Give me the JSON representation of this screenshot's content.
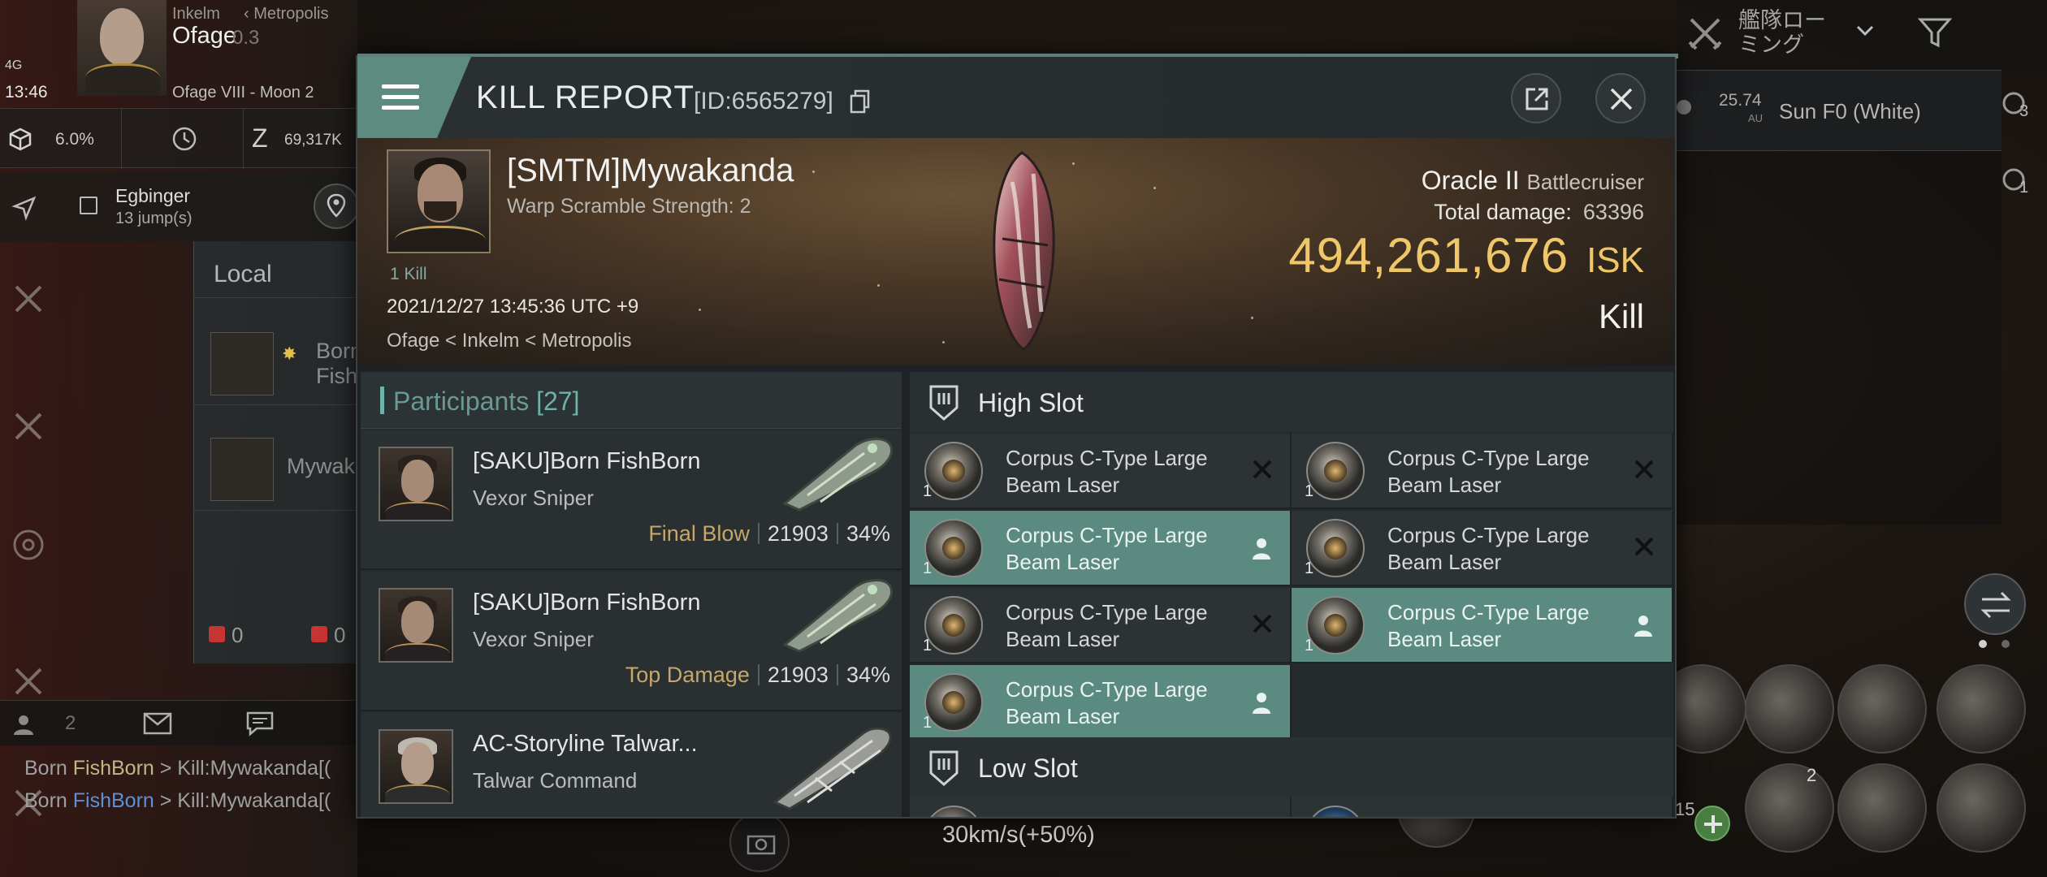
{
  "hud": {
    "region": "Inkelm",
    "constellation": "Metropolis",
    "system": "Ofage",
    "security": "0.3",
    "signal": "4G",
    "time": "13:46",
    "location": "Ofage VIII - Moon 2",
    "stats": [
      "6.0%",
      "69,317K"
    ],
    "route_destination": "Egbinger",
    "route_jumps": "13 jump(s)",
    "local_title": "Local",
    "local_rows": [
      "Born Fish",
      "Mywak"
    ],
    "flags": [
      "0",
      "0"
    ],
    "chat_count": "2",
    "chat_lines": [
      {
        "prefix": "Born ",
        "name": "FishBorn",
        "text": " > Kill:Mywakanda[("
      },
      {
        "prefix": "Born ",
        "name": "FishBorn",
        "text": " > Kill:Mywakanda[("
      }
    ],
    "fleet_label": "艦隊ローミング",
    "sun_distance": "25.74",
    "sun_distance_unit": "AU",
    "sun_name": "Sun F0 (White)",
    "right_counts": [
      "3",
      "1"
    ],
    "speed": "30km/s(+50%)",
    "module_badges": [
      "15",
      "2"
    ]
  },
  "report": {
    "title": "KILL REPORT",
    "id": "[ID:6565279]",
    "victim_name": "[SMTM]Mywakanda",
    "victim_sub": "Warp Scramble Strength: 2",
    "kill_count": "1 Kill",
    "date": "2021/12/27 13:45:36 UTC +9",
    "location": "Ofage < Inkelm < Metropolis",
    "ship": "Oracle II",
    "ship_class": "Battlecruiser",
    "total_damage_label": "Total damage:",
    "total_damage": "63396",
    "isk_value": "494,261,676",
    "isk_unit": "ISK",
    "result": "Kill"
  },
  "participants": {
    "title": "Participants",
    "count": "[27]",
    "rows": [
      {
        "name": "[SAKU]Born FishBorn",
        "ship": "Vexor Sniper",
        "tag": "Final Blow",
        "damage": "21903",
        "pct": "34%"
      },
      {
        "name": "[SAKU]Born FishBorn",
        "ship": "Vexor Sniper",
        "tag": "Top Damage",
        "damage": "21903",
        "pct": "34%"
      },
      {
        "name": "AC-Storyline Talwar...",
        "ship": "Talwar Command",
        "tag": "",
        "damage": "",
        "pct": ""
      }
    ]
  },
  "slots": {
    "high_label": "High Slot",
    "low_label": "Low Slot",
    "high_modules": [
      {
        "qty": "1",
        "name": "Corpus C-Type Large Beam Laser",
        "state": "destroyed"
      },
      {
        "qty": "1",
        "name": "Corpus C-Type Large Beam Laser",
        "state": "destroyed"
      },
      {
        "qty": "1",
        "name": "Corpus C-Type Large Beam Laser",
        "state": "dropped"
      },
      {
        "qty": "1",
        "name": "Corpus C-Type Large Beam Laser",
        "state": "destroyed"
      },
      {
        "qty": "1",
        "name": "Corpus C-Type Large Beam Laser",
        "state": "destroyed"
      },
      {
        "qty": "1",
        "name": "Corpus C-Type Large Beam Laser",
        "state": "dropped"
      },
      {
        "qty": "1",
        "name": "Corpus C-Type Large Beam Laser",
        "state": "dropped"
      }
    ]
  },
  "colors": {
    "accent": "#5d8b7f",
    "isk": "#f0c768",
    "final_blow": "#c4a76a",
    "dropped_bg": "#5a8a80"
  }
}
